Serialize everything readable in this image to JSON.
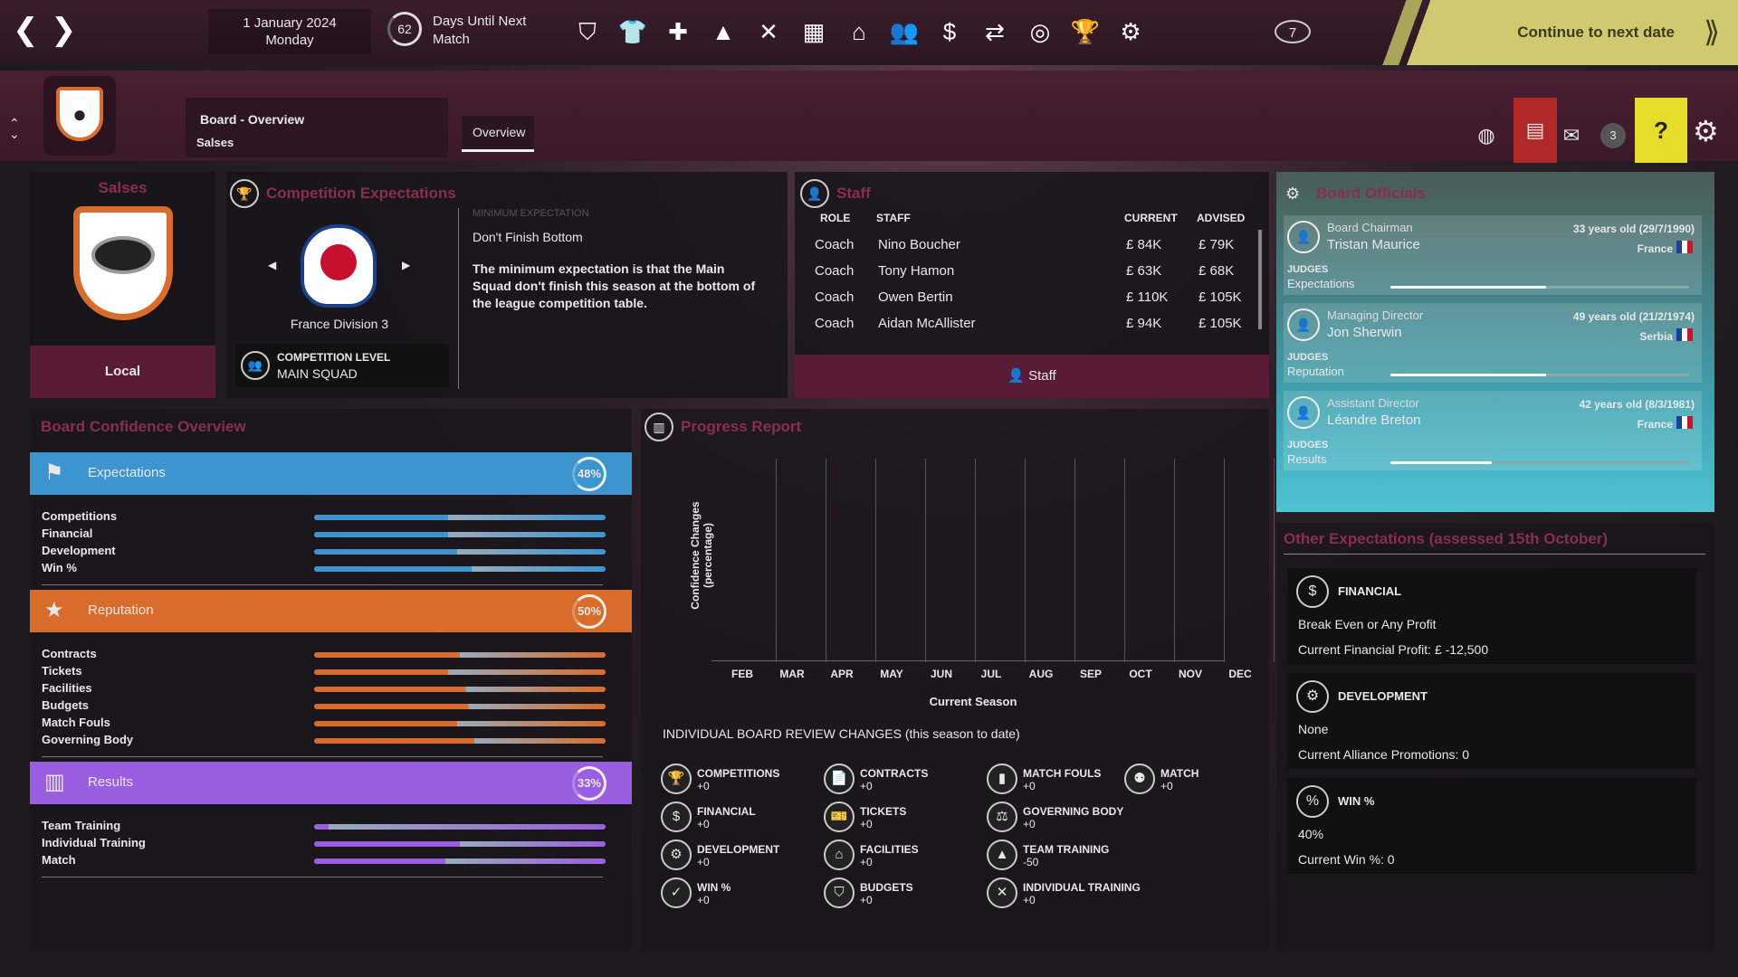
{
  "topbar": {
    "date": "1 January 2024",
    "day": "Monday",
    "days_until": "62",
    "days_label_1": "Days Until Next",
    "days_label_2": "Match",
    "alerts": "7",
    "continue_label": "Continue to next date"
  },
  "header": {
    "title": "Board - Overview",
    "subtitle": "Salses",
    "tab": "Overview",
    "inbox_count": "3"
  },
  "club": {
    "name": "Salses",
    "local_label": "Local"
  },
  "competition": {
    "title": "Competition Expectations",
    "name": "France Division 3",
    "level_label": "COMPETITION LEVEL",
    "level_value": "MAIN SQUAD",
    "min_label": "MINIMUM EXPECTATION",
    "min_value": "Don't Finish Bottom",
    "min_desc": "The minimum expectation is that the Main Squad don't finish this season at the bottom of the league competition table."
  },
  "staff": {
    "title": "Staff",
    "headers": {
      "role": "ROLE",
      "staff": "STAFF",
      "current": "CURRENT",
      "advised": "ADVISED"
    },
    "rows": [
      {
        "role": "Coach",
        "name": "Nino Boucher",
        "current": "£ 84K",
        "advised": "£ 79K"
      },
      {
        "role": "Coach",
        "name": "Tony Hamon",
        "current": "£ 63K",
        "advised": "£ 68K"
      },
      {
        "role": "Coach",
        "name": "Owen Bertin",
        "current": "£ 110K",
        "advised": "£ 105K"
      },
      {
        "role": "Coach",
        "name": "Aidan McAllister",
        "current": "£ 94K",
        "advised": "£ 105K"
      }
    ],
    "button": "Staff"
  },
  "confidence": {
    "title": "Board Confidence Overview",
    "expectations": {
      "label": "Expectations",
      "pct": "48%",
      "items": [
        {
          "label": "Competitions",
          "v": 0.46
        },
        {
          "label": "Financial",
          "v": 0.46
        },
        {
          "label": "Development",
          "v": 0.49
        },
        {
          "label": "Win %",
          "v": 0.54
        }
      ]
    },
    "reputation": {
      "label": "Reputation",
      "pct": "50%",
      "items": [
        {
          "label": "Contracts",
          "v": 0.5
        },
        {
          "label": "Tickets",
          "v": 0.46
        },
        {
          "label": "Facilities",
          "v": 0.52
        },
        {
          "label": "Budgets",
          "v": 0.53
        },
        {
          "label": "Match Fouls",
          "v": 0.49
        },
        {
          "label": "Governing Body",
          "v": 0.55
        }
      ]
    },
    "results": {
      "label": "Results",
      "pct": "33%",
      "items": [
        {
          "label": "Team Training",
          "v": 0.05
        },
        {
          "label": "Individual Training",
          "v": 0.5
        },
        {
          "label": "Match",
          "v": 0.45
        }
      ]
    }
  },
  "progress": {
    "title": "Progress Report",
    "ylabel": "Confidence Changes (percentage)",
    "xlabel": "Current Season",
    "months": [
      "FEB",
      "MAR",
      "APR",
      "MAY",
      "JUN",
      "JUL",
      "AUG",
      "SEP",
      "OCT",
      "NOV",
      "DEC"
    ],
    "review_title": "INDIVIDUAL BOARD REVIEW CHANGES (this season to date)",
    "reviews": [
      {
        "label": "COMPETITIONS",
        "value": "+0",
        "icon": "trophy-icon",
        "glyph": "🏆"
      },
      {
        "label": "CONTRACTS",
        "value": "+0",
        "icon": "contract-icon",
        "glyph": "📄"
      },
      {
        "label": "MATCH FOULS",
        "value": "+0",
        "icon": "card-icon",
        "glyph": "▮"
      },
      {
        "label": "MATCH",
        "value": "+0",
        "icon": "match-icon",
        "glyph": "⚉"
      },
      {
        "label": "FINANCIAL",
        "value": "+0",
        "icon": "money-icon",
        "glyph": "$"
      },
      {
        "label": "TICKETS",
        "value": "+0",
        "icon": "ticket-icon",
        "glyph": "🎫"
      },
      {
        "label": "GOVERNING BODY",
        "value": "+0",
        "icon": "governing-icon",
        "glyph": "⚖"
      },
      {
        "label": "DEVELOPMENT",
        "value": "+0",
        "icon": "development-icon",
        "glyph": "⚙"
      },
      {
        "label": "FACILITIES",
        "value": "+0",
        "icon": "facilities-icon",
        "glyph": "⌂"
      },
      {
        "label": "TEAM TRAINING",
        "value": "-50",
        "icon": "cone-icon",
        "glyph": "▲"
      },
      {
        "label": "WIN %",
        "value": "+0",
        "icon": "check-icon",
        "glyph": "✓"
      },
      {
        "label": "BUDGETS",
        "value": "+0",
        "icon": "shield-icon",
        "glyph": "⛉"
      },
      {
        "label": "INDIVIDUAL TRAINING",
        "value": "+0",
        "icon": "tactics-icon",
        "glyph": "✕"
      }
    ]
  },
  "officials": {
    "title": "Board Officials",
    "list": [
      {
        "role": "Board Chairman",
        "name": "Tristan Maurice",
        "age": "33 years old (29/7/1990)",
        "country": "France",
        "judges_label": "JUDGES",
        "judges": "Expectations",
        "v": 0.52
      },
      {
        "role": "Managing Director",
        "name": "Jon Sherwin",
        "age": "49 years old (21/2/1974)",
        "country": "Serbia",
        "judges_label": "JUDGES",
        "judges": "Reputation",
        "v": 0.52
      },
      {
        "role": "Assistant Director",
        "name": "Léandre Breton",
        "age": "42 years old (8/3/1981)",
        "country": "France",
        "judges_label": "JUDGES",
        "judges": "Results",
        "v": 0.34
      }
    ]
  },
  "other": {
    "title": "Other Expectations (assessed 15th October)",
    "list": [
      {
        "heading": "FINANCIAL",
        "line1": "Break Even or Any Profit",
        "line2": "Current Financial Profit: £ -12,500",
        "glyph": "$"
      },
      {
        "heading": "DEVELOPMENT",
        "line1": "None",
        "line2": "Current Alliance Promotions: 0",
        "glyph": "⚙"
      },
      {
        "heading": "WIN %",
        "line1": "40%",
        "line2": "Current Win %: 0",
        "glyph": "%"
      }
    ]
  },
  "colors": {
    "expectations": "#3d95cf",
    "reputation": "#d96c2a",
    "results": "#9a5fe0",
    "accent": "#8b2e4c",
    "officials": "#4fb5c4"
  }
}
